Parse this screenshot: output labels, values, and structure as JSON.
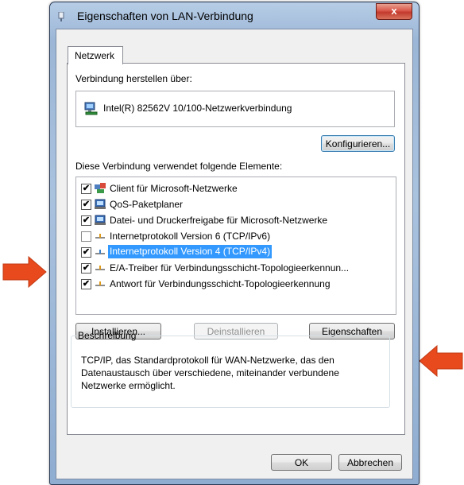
{
  "window": {
    "title": "Eigenschaften von LAN-Verbindung",
    "close_glyph": "x"
  },
  "tabs": [
    {
      "label": "Netzwerk"
    }
  ],
  "connect_via": {
    "label": "Verbindung herstellen über:",
    "adapter": "Intel(R) 82562V 10/100-Netzwerkverbindung",
    "configure_button": "Konfigurieren..."
  },
  "items": {
    "label": "Diese Verbindung verwendet folgende Elemente:",
    "list": [
      {
        "label": "Client für Microsoft-Netzwerke",
        "checked": true,
        "icon": "network-client-icon"
      },
      {
        "label": "QoS-Paketplaner",
        "checked": true,
        "icon": "service-icon"
      },
      {
        "label": "Datei- und Druckerfreigabe für Microsoft-Netzwerke",
        "checked": true,
        "icon": "service-icon"
      },
      {
        "label": "Internetprotokoll Version 6 (TCP/IPv6)",
        "checked": false,
        "icon": "protocol-icon"
      },
      {
        "label": "Internetprotokoll Version 4 (TCP/IPv4)",
        "checked": true,
        "icon": "protocol-icon",
        "selected": true
      },
      {
        "label": "E/A-Treiber für Verbindungsschicht-Topologieerkennun...",
        "checked": true,
        "icon": "protocol-icon"
      },
      {
        "label": "Antwort für Verbindungsschicht-Topologieerkennung",
        "checked": true,
        "icon": "protocol-icon"
      }
    ]
  },
  "actions": {
    "install": "Installieren...",
    "uninstall": "Deinstallieren",
    "properties": "Eigenschaften"
  },
  "description": {
    "legend": "Beschreibung",
    "text": "TCP/IP, das Standardprotokoll für WAN-Netzwerke, das den Datenaustausch über verschiedene, miteinander verbundene Netzwerke ermöglicht."
  },
  "footer": {
    "ok": "OK",
    "cancel": "Abbrechen"
  },
  "colors": {
    "arrow": "#e8491d",
    "selection": "#3399ff"
  }
}
